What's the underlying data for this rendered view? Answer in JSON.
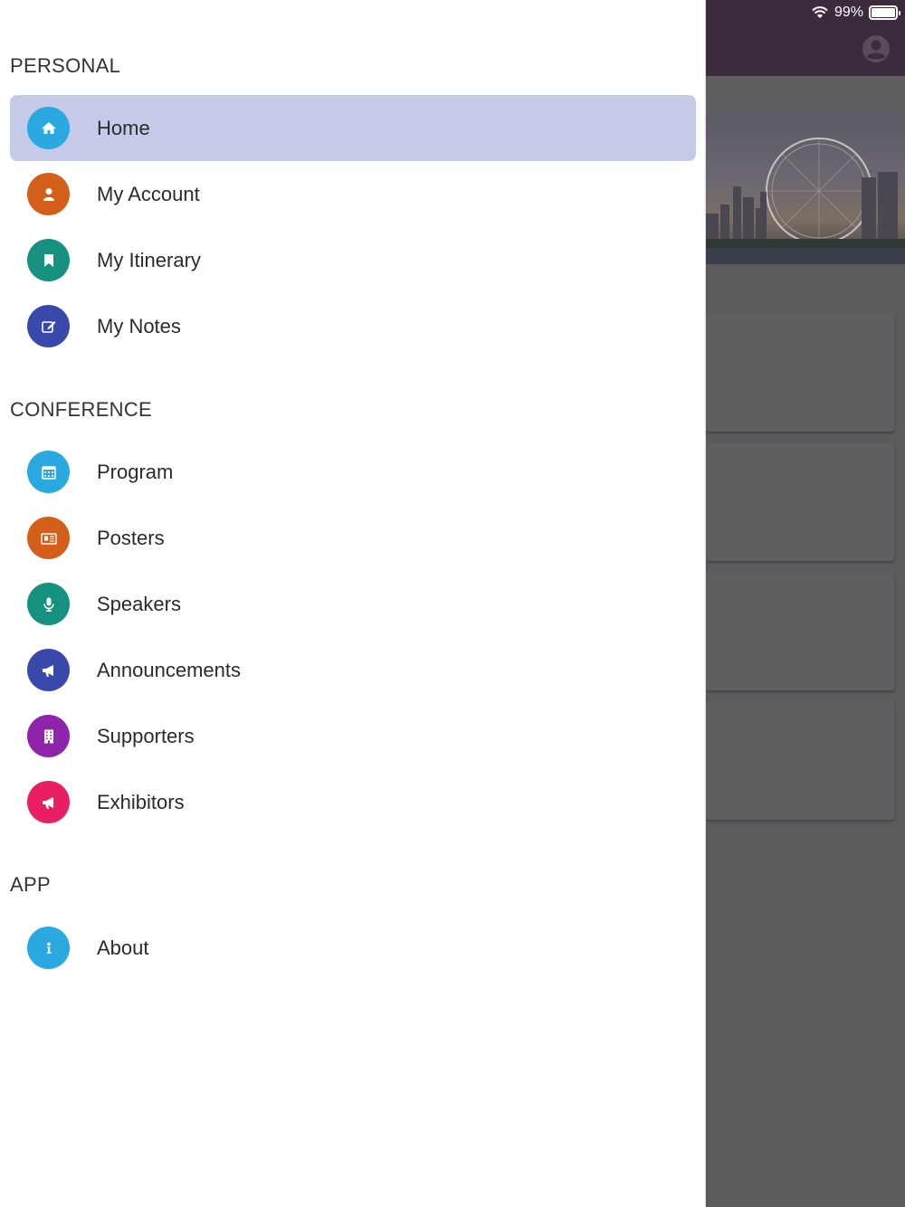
{
  "status_bar": {
    "battery": "99%",
    "battery_level": 0.99
  },
  "sections": [
    {
      "title": "PERSONAL",
      "items": [
        {
          "label": "Home",
          "icon": "home-icon",
          "color": "#29a9e0",
          "active": true
        },
        {
          "label": "My Account",
          "icon": "user-icon",
          "color": "#d35f1a"
        },
        {
          "label": "My Itinerary",
          "icon": "bookmark-icon",
          "color": "#16917f"
        },
        {
          "label": "My Notes",
          "icon": "edit-icon",
          "color": "#3949ab"
        }
      ]
    },
    {
      "title": "CONFERENCE",
      "items": [
        {
          "label": "Program",
          "icon": "calendar-icon",
          "color": "#29a9e0"
        },
        {
          "label": "Posters",
          "icon": "newspaper-icon",
          "color": "#d35f1a"
        },
        {
          "label": "Speakers",
          "icon": "microphone-icon",
          "color": "#16917f"
        },
        {
          "label": "Announcements",
          "icon": "megaphone-icon",
          "color": "#3949ab"
        },
        {
          "label": "Supporters",
          "icon": "building-icon",
          "color": "#8e24aa"
        },
        {
          "label": "Exhibitors",
          "icon": "megaphone-icon",
          "color": "#e91e63"
        }
      ]
    },
    {
      "title": "APP",
      "items": [
        {
          "label": "About",
          "icon": "info-icon",
          "color": "#29a9e0"
        }
      ]
    }
  ]
}
